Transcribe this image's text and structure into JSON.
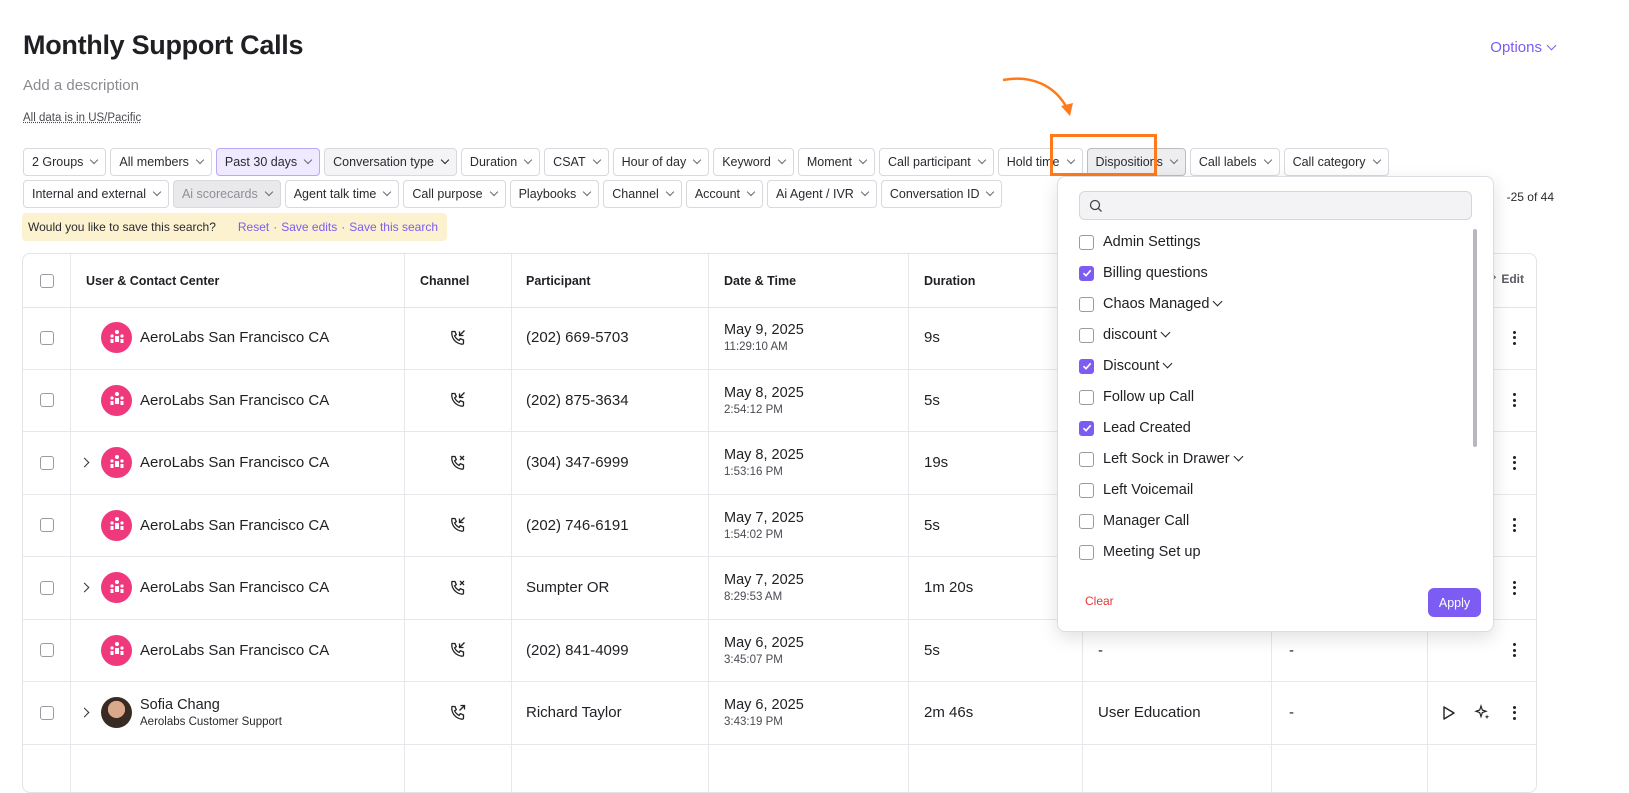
{
  "header": {
    "title": "Monthly Support Calls",
    "description_placeholder": "Add a description",
    "timezone_note": "All data is in US/Pacific",
    "options_label": "Options"
  },
  "filters": {
    "row1": [
      "2 Groups",
      "All members",
      "Past 30 days",
      "Conversation type",
      "Duration",
      "CSAT",
      "Hour of day",
      "Keyword",
      "Moment",
      "Call participant",
      "Hold time",
      "Dispositions",
      "Call labels",
      "Call category"
    ],
    "row2": [
      "Internal and external",
      "Ai scorecards",
      "Agent talk time",
      "Call purpose",
      "Playbooks",
      "Channel",
      "Account",
      "Ai Agent / IVR",
      "Conversation ID"
    ]
  },
  "save_bar": {
    "message": "Would you like to save this search?",
    "reset": "Reset",
    "save_edits": "Save edits",
    "save_search": "Save this search",
    "separator": "·"
  },
  "pagination": {
    "range": "-25 of 44"
  },
  "table": {
    "columns": [
      "User & Contact Center",
      "Channel",
      "Participant",
      "Date & Time",
      "Duration"
    ],
    "edit_label": "Edit",
    "rows": [
      {
        "name": "AeroLabs San Francisco CA",
        "sub": "",
        "participant": "(202) 669-5703",
        "date": "May 9, 2025",
        "time": "11:29:10 AM",
        "duration": "9s",
        "col6": "",
        "col7": ""
      },
      {
        "name": "AeroLabs San Francisco CA",
        "sub": "",
        "participant": "(202) 875-3634",
        "date": "May 8, 2025",
        "time": "2:54:12 PM",
        "duration": "5s",
        "col6": "",
        "col7": ""
      },
      {
        "name": "AeroLabs San Francisco CA",
        "sub": "",
        "participant": "(304) 347-6999",
        "date": "May 8, 2025",
        "time": "1:53:16 PM",
        "duration": "19s",
        "col6": "",
        "col7": ""
      },
      {
        "name": "AeroLabs San Francisco CA",
        "sub": "",
        "participant": "(202) 746-6191",
        "date": "May 7, 2025",
        "time": "1:54:02 PM",
        "duration": "5s",
        "col6": "",
        "col7": ""
      },
      {
        "name": "AeroLabs San Francisco CA",
        "sub": "",
        "participant": "Sumpter OR",
        "date": "May 7, 2025",
        "time": "8:29:53 AM",
        "duration": "1m 20s",
        "col6": "",
        "col7": ""
      },
      {
        "name": "AeroLabs San Francisco CA",
        "sub": "",
        "participant": "(202) 841-4099",
        "date": "May 6, 2025",
        "time": "3:45:07 PM",
        "duration": "5s",
        "col6": "-",
        "col7": "-"
      },
      {
        "name": "Sofia Chang",
        "sub": "Aerolabs Customer Support",
        "participant": "Richard Taylor",
        "date": "May 6, 2025",
        "time": "3:43:19 PM",
        "duration": "2m 46s",
        "col6": "User Education",
        "col7": "-"
      }
    ]
  },
  "dispositions_dropdown": {
    "search_placeholder": "",
    "items": [
      {
        "label": "Admin Settings",
        "checked": false,
        "has_children": false
      },
      {
        "label": "Billing questions",
        "checked": true,
        "has_children": false
      },
      {
        "label": "Chaos Managed",
        "checked": false,
        "has_children": true
      },
      {
        "label": "discount",
        "checked": false,
        "has_children": true
      },
      {
        "label": "Discount",
        "checked": true,
        "has_children": true
      },
      {
        "label": "Follow up Call",
        "checked": false,
        "has_children": false
      },
      {
        "label": "Lead Created",
        "checked": true,
        "has_children": false
      },
      {
        "label": "Left Sock in Drawer",
        "checked": false,
        "has_children": true
      },
      {
        "label": "Left Voicemail",
        "checked": false,
        "has_children": false
      },
      {
        "label": "Manager Call",
        "checked": false,
        "has_children": false
      },
      {
        "label": "Meeting Set up",
        "checked": false,
        "has_children": false
      }
    ],
    "clear_label": "Clear",
    "apply_label": "Apply"
  },
  "colors": {
    "accent": "#7c5cf2",
    "highlight": "#ff7a1a",
    "avatar": "#f0397d",
    "danger": "#e03a3a"
  }
}
